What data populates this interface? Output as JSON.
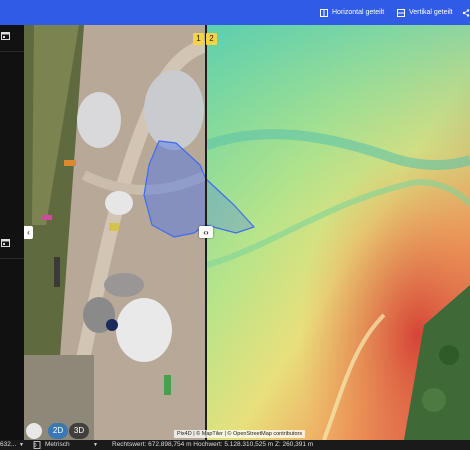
{
  "toolbar": {
    "horizontal_label": "Horizontal geteilt",
    "vertical_label": "Vertikal geteilt"
  },
  "map": {
    "badge_left": "1",
    "badge_right": "2",
    "view_2d": "2D",
    "view_3d": "3D",
    "attribution": "Pix4D | © MapTiler | © OpenStreetMap contributors"
  },
  "statusbar": {
    "left_value": "632...",
    "units": "Metrisch",
    "coordinates": "Rechtswert: 672.898,754 m  Hochwert: 5.128.310,525 m  Z: 260,391 m"
  },
  "colors": {
    "toolbar": "#2f5be6",
    "selection": "#3d6cf0",
    "badge": "#f5d442",
    "view_2d": "#3a78b5"
  }
}
